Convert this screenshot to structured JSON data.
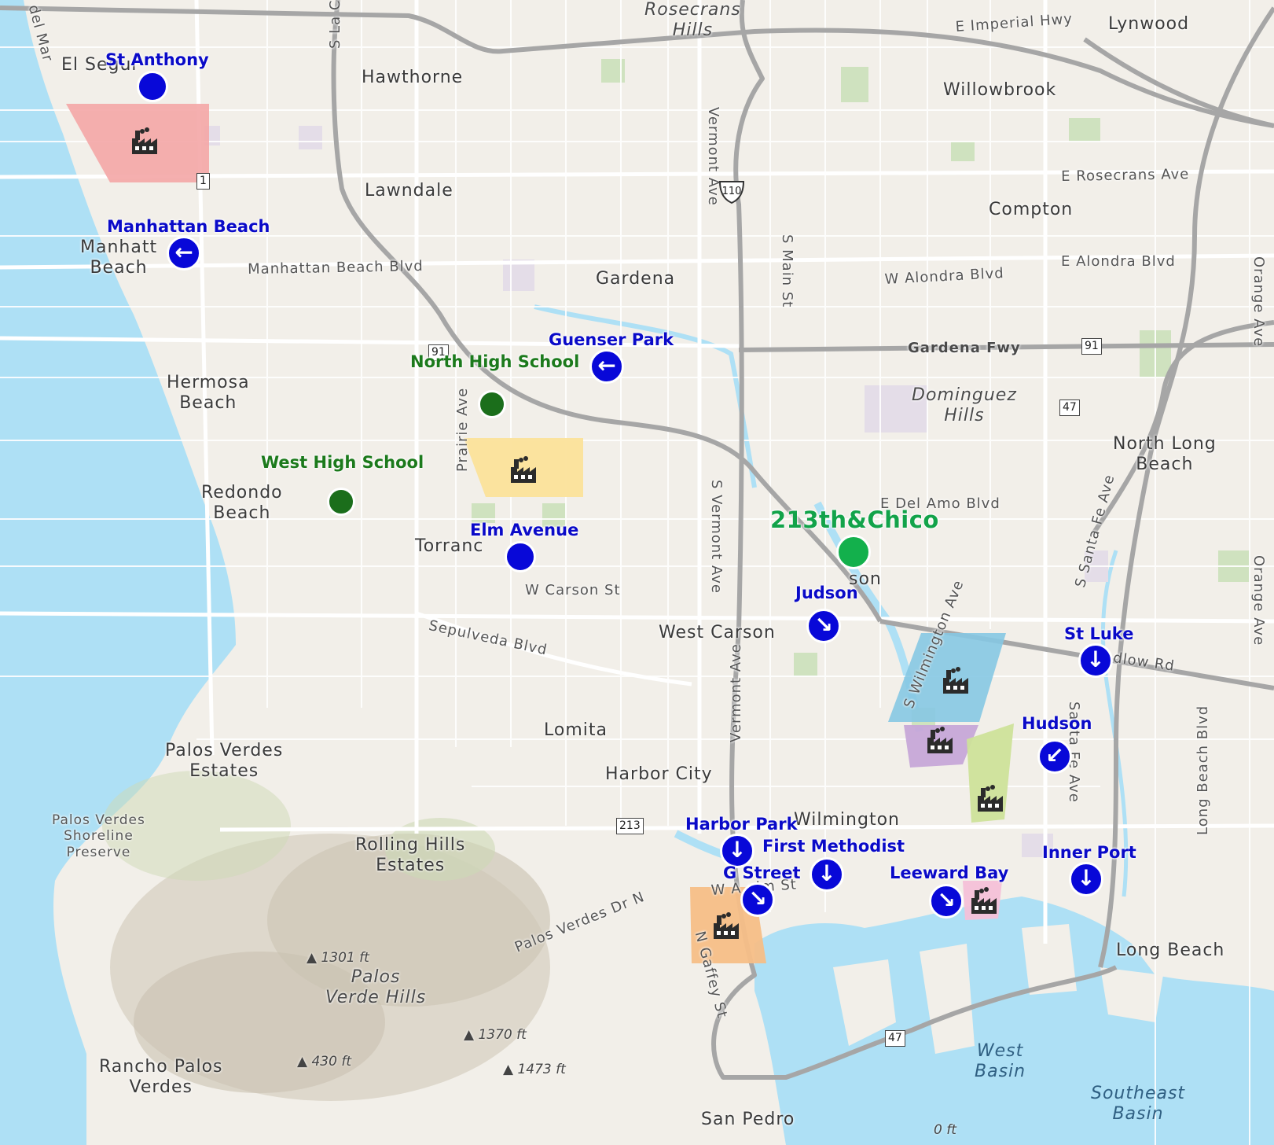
{
  "map": {
    "places": [
      {
        "name": "Rosecrans",
        "name2": "Hills"
      },
      {
        "name": "Lynwood"
      },
      {
        "name": "El Segur"
      },
      {
        "name": "Hawthorne"
      },
      {
        "name": "Willowbrook"
      },
      {
        "name": "Lawndale"
      },
      {
        "name": "Compton"
      },
      {
        "name": "Manhatt",
        "name2": "Beach"
      },
      {
        "name": "Gardena"
      },
      {
        "name": "Hermosa",
        "name2": "Beach"
      },
      {
        "name": "Dominguez",
        "name2": "Hills"
      },
      {
        "name": "North Long",
        "name2": "Beach"
      },
      {
        "name": "Redondo",
        "name2": "Beach"
      },
      {
        "name": "Torranc"
      },
      {
        "name": "son"
      },
      {
        "name": "West Carson"
      },
      {
        "name": "Lomita"
      },
      {
        "name": "Palos Verdes",
        "name2": "Estates"
      },
      {
        "name": "Harbor City"
      },
      {
        "name": "Palos Verdes",
        "name2": "Shoreline",
        "name3": "Preserve"
      },
      {
        "name": "Wilmington"
      },
      {
        "name": "Rolling Hills",
        "name2": "Estates"
      },
      {
        "name": "Long Beach"
      },
      {
        "name": "Palos",
        "name2": "Verde Hills"
      },
      {
        "name": "Rancho Palos",
        "name2": "Verdes"
      },
      {
        "name": "San Pedro"
      },
      {
        "name": "West",
        "name2": "Basin"
      },
      {
        "name": "Southeast",
        "name2": "Basin"
      }
    ],
    "elevations": [
      "1301 ft",
      "1370 ft",
      "430 ft",
      "1473 ft",
      "0 ft"
    ],
    "roads": [
      "E Imperial Hwy",
      "E Rosecrans Ave",
      "Manhattan Beach Blvd",
      "W Alondra Blvd",
      "E Alondra Blvd",
      "Gardena Fwy",
      "E Del Amo Blvd",
      "W Carson St",
      "Sepulveda Blvd",
      "Vermont Ave",
      "S Vermont Ave",
      "S Main St",
      "Prairie Ave",
      "S La C",
      "S Wilmington Ave",
      "S Santa Fe Ave",
      "Santa Fe Ave",
      "Long Beach Blvd",
      "Orange Ave",
      "Orange Ave",
      "N Gaffey St",
      "Palos Verdes Dr N",
      "W A eim St",
      "dlow Rd",
      "del Mar",
      "Vermont Ave"
    ],
    "shields": [
      "1",
      "110",
      "91",
      "91",
      "47",
      "213",
      "47"
    ]
  },
  "markers": [
    {
      "label": "St Anthony",
      "kind": "blue-dot"
    },
    {
      "label": "Manhattan Beach",
      "kind": "arrow",
      "arrow": "←"
    },
    {
      "label": "Guenser Park",
      "kind": "arrow",
      "arrow": "←"
    },
    {
      "label": "North High School",
      "kind": "green-dot"
    },
    {
      "label": "West High School",
      "kind": "green-dot"
    },
    {
      "label": "Elm Avenue",
      "kind": "blue-dot"
    },
    {
      "label": "213th&Chico",
      "kind": "bright-green-dot"
    },
    {
      "label": "Judson",
      "kind": "arrow",
      "arrow": "↘"
    },
    {
      "label": "St Luke",
      "kind": "arrow",
      "arrow": "↓"
    },
    {
      "label": "Hudson",
      "kind": "arrow",
      "arrow": "↙"
    },
    {
      "label": "Harbor Park",
      "kind": "arrow",
      "arrow": "↓"
    },
    {
      "label": "First Methodist",
      "kind": "arrow",
      "arrow": "↓"
    },
    {
      "label": "G Street",
      "kind": "arrow",
      "arrow": "↘"
    },
    {
      "label": "Leeward Bay",
      "kind": "arrow",
      "arrow": "↘"
    },
    {
      "label": "Inner Port",
      "kind": "arrow",
      "arrow": "↓"
    }
  ],
  "facilities": [
    {
      "color": "#f4a6a6",
      "icon": "factory-icon"
    },
    {
      "color": "#fbe29a",
      "icon": "factory-icon"
    },
    {
      "color": "#86c8e3",
      "icon": "factory-icon"
    },
    {
      "color": "#c6a7d8",
      "icon": "factory-icon"
    },
    {
      "color": "#cde29a",
      "icon": "factory-icon"
    },
    {
      "color": "#f4c0d8",
      "icon": "factory-icon"
    },
    {
      "color": "#f6be87",
      "icon": "factory-icon"
    }
  ],
  "colors": {
    "water": "#aee0f5",
    "land": "#f2efe9",
    "monitor_blue": "#0808d8",
    "school_green": "#1b6e1b",
    "site_green": "#13b04c"
  }
}
